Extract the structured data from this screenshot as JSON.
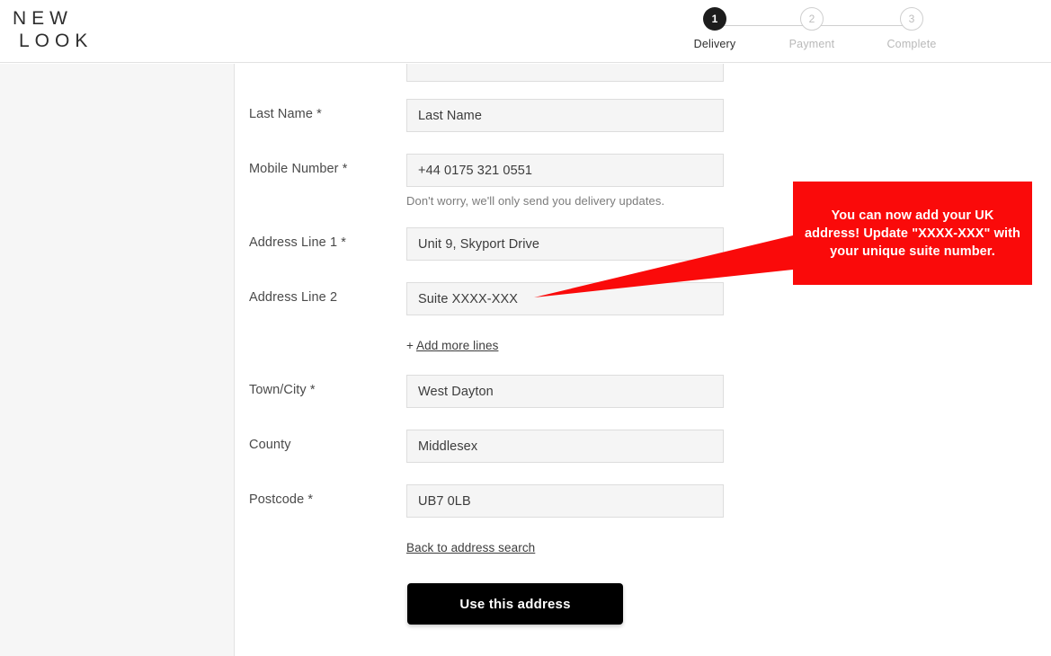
{
  "header": {
    "logo_line1": "NEW",
    "logo_line2": "LOOK"
  },
  "steps": [
    {
      "number": "1",
      "label": "Delivery",
      "state": "active"
    },
    {
      "number": "2",
      "label": "Payment",
      "state": "inactive"
    },
    {
      "number": "3",
      "label": "Complete",
      "state": "inactive"
    }
  ],
  "form": {
    "fields": [
      {
        "label": "",
        "value": "",
        "cut_off": true
      },
      {
        "label": "Last Name",
        "required": true,
        "value": "Last Name"
      },
      {
        "label": "Mobile Number",
        "required": true,
        "value": "+44 0175 321 0551",
        "hint": "Don't worry, we'll only send you delivery updates."
      },
      {
        "label": "Address Line 1",
        "required": true,
        "value": "Unit 9, Skyport Drive"
      },
      {
        "label": "Address Line 2",
        "required": false,
        "value": "Suite XXXX-XXX"
      },
      {
        "label": "Town/City",
        "required": true,
        "value": "West Dayton"
      },
      {
        "label": "County",
        "required": false,
        "value": "Middlesex"
      },
      {
        "label": "Postcode",
        "required": true,
        "value": "UB7 0LB"
      }
    ],
    "add_more_lines_plus": "+",
    "add_more_lines_label": "Add more lines",
    "back_to_search_label": "Back to address search",
    "submit_label": "Use this address"
  },
  "callout": {
    "text": "You can now add your UK address! Update \"XXXX-XXX\" with your unique suite number.",
    "color": "#fa0a0a"
  },
  "colors": {
    "accent_red": "#fa0a0a",
    "button_black": "#000000",
    "panel_grey": "#f6f6f6",
    "input_grey": "#f5f5f5"
  }
}
